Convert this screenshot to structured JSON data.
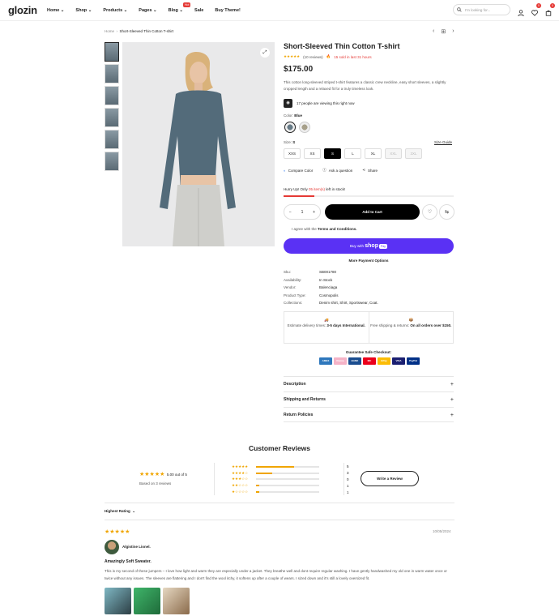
{
  "header": {
    "logo": "glozin",
    "nav": [
      {
        "label": "Home"
      },
      {
        "label": "Shop"
      },
      {
        "label": "Products"
      },
      {
        "label": "Pages"
      },
      {
        "label": "Blog"
      },
      {
        "label": "Sale"
      },
      {
        "label": "Buy Theme!"
      }
    ],
    "hot_badge": "Hot",
    "search_placeholder": "I'm looking for...",
    "wishlist_count": "0",
    "cart_count": "0"
  },
  "breadcrumb": {
    "home": "Home",
    "current": "Short-Sleeved Thin Cotton T-shirt"
  },
  "product": {
    "title": "Short-Sleeved Thin Cotton T-shirt",
    "rating_stars": "★★★★★",
    "reviews": "(10 reviews)",
    "sold": "15 sold in last 31 hours",
    "price": "$175.00",
    "description": "This cotton long-sleeved striped t-shirt features a classic crew neckline, easy short sleeves, a slightly cropped length and a relaxed fit for a truly timeless look.",
    "viewing": "17 people are viewing this right now",
    "color_label": "Color:",
    "color_value": "Blue",
    "size_label": "Size:",
    "size_value": "S",
    "sizes": [
      "XXS",
      "XS",
      "S",
      "L",
      "XL",
      "XXL",
      "3XL"
    ],
    "size_guide": "Size Guide",
    "compare": "Compare Color",
    "ask": "Ask a question",
    "share": "Share",
    "hurry_prefix": "Hurry Up! Only",
    "hurry_count": "05 item(s)",
    "hurry_suffix": "left in stock!",
    "stock_fraction": 0.18,
    "qty": "1",
    "add_to_cart": "Add to Cart",
    "agree_prefix": "I agree with the",
    "agree_link": "Terms and Conditions.",
    "buy_with": "Buy with",
    "shop_word": "shop",
    "pay_word": "Pay",
    "more_payment": "More Payment Options"
  },
  "meta": [
    {
      "k": "Sku:",
      "v": "SB001780"
    },
    {
      "k": "Availability:",
      "v": "In Stock"
    },
    {
      "k": "Vendor:",
      "v": "Balenciaga"
    },
    {
      "k": "Product Type:",
      "v": "Cosmopolis"
    },
    {
      "k": "Collections:",
      "v": "Denim shirt, Shirt, Sportswear, Coat."
    }
  ],
  "shipping": {
    "d1": "Estimate delivery times:",
    "d1b": "3-5 days International.",
    "d2": "Free shipping & returns:",
    "d2b": "On all orders over $150."
  },
  "guarantee": "Guarantee Safe Checkout:",
  "payments": [
    {
      "name": "AMEX",
      "color": "#2e77bc"
    },
    {
      "name": "Klarna",
      "color": "#f5b3c7"
    },
    {
      "name": "BANK",
      "color": "#1a4d8f"
    },
    {
      "name": "MC",
      "color": "#eb001b"
    },
    {
      "name": "GPay",
      "color": "#fbbc05"
    },
    {
      "name": "VISA",
      "color": "#1a1f71"
    },
    {
      "name": "PayPal",
      "color": "#003087"
    }
  ],
  "accordions": [
    "Description",
    "Shipping and Returns",
    "Return Policies"
  ],
  "reviews": {
    "heading": "Customer Reviews",
    "avg_stars": "★★★★★",
    "avg_text": "5.00 out of 5",
    "based": "Based on 3 reviews",
    "dist": [
      {
        "stars": "★★★★★",
        "count": "5",
        "frac": 0.6
      },
      {
        "stars": "★★★★☆",
        "count": "3",
        "frac": 0.25
      },
      {
        "stars": "★★★☆☆",
        "count": "0",
        "frac": 0
      },
      {
        "stars": "★★☆☆☆",
        "count": "1",
        "frac": 0.05
      },
      {
        "stars": "★☆☆☆☆",
        "count": "1",
        "frac": 0.05
      }
    ],
    "write": "Write a Review",
    "sort": "Highest Rating",
    "item": {
      "stars": "★★★★★",
      "date": "10/05/2024",
      "name": "Algistine Lionel.",
      "title": "Amazingly Soft Sweater.",
      "body": "This is my second of these jumpers – I love how light and warm they are especially under a jacket. They breathe well and dont require regular washing. I have gently handwashed my old one in warm water once or twice without any issues. The sleeves are flattering and I don't find the wool itchy, it softens up after a couple of wears. I sized down and it's still a lovely oversized fit."
    }
  }
}
